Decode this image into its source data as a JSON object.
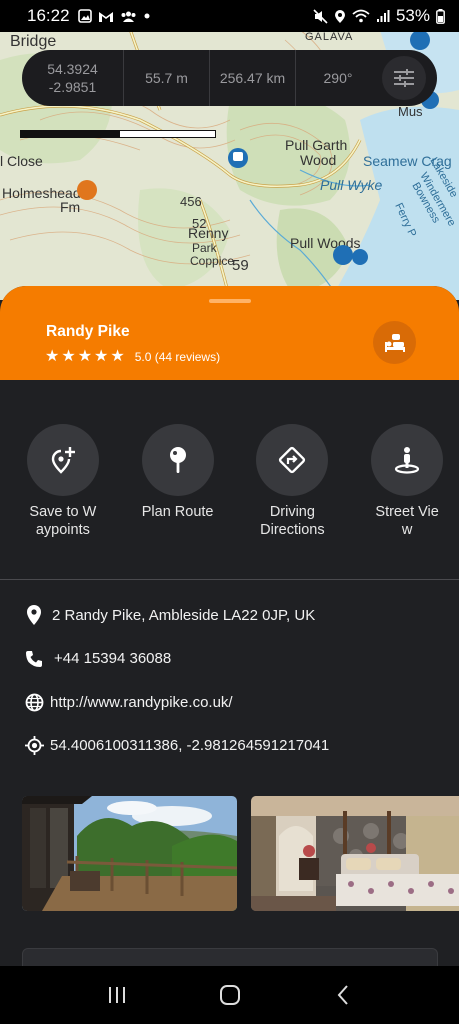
{
  "status_bar": {
    "time": "16:22",
    "battery_percent": "53%",
    "icons_left": [
      "photo-icon",
      "gallery-icon",
      "gmail-icon",
      "group-icon",
      "dot-icon"
    ],
    "icons_right": [
      "mute-icon",
      "location-icon",
      "wifi-icon",
      "signal-icon",
      "battery-icon"
    ]
  },
  "map": {
    "labels": [
      "Bridge",
      "Pull Garth Wood",
      "Seamew Crag",
      "Pull Wyke",
      "Holmeshead Fm",
      "Renny Park",
      "Pull Woods",
      "Bowness Windermere Lakeside",
      "Ferry P",
      "456",
      "52",
      "59",
      "GALAVA",
      "Mus",
      "l Close",
      "Coppice"
    ],
    "colors": {
      "land": "#dfe3cf",
      "water": "#bfe3f2",
      "road": "#f4f4c4",
      "wood": "#c8dcb0"
    }
  },
  "info_bar": {
    "latitude": "54.3924",
    "longitude": "-2.9851",
    "altitude": "55.7 m",
    "distance": "256.47 km",
    "heading": "290°",
    "filter_icon": "sliders-icon"
  },
  "scale_bar": {
    "fill_fraction": 0.51
  },
  "place": {
    "name": "Randy Pike",
    "rating_value": 5.0,
    "stars": 5,
    "rating_text": "5.0 (44 reviews)",
    "category_icon": "bed-icon",
    "accent_color": "#f57c00"
  },
  "actions": [
    {
      "label": "Save to Waypoints",
      "icon": "add-location-icon"
    },
    {
      "label": "Plan Route",
      "icon": "pin-icon"
    },
    {
      "label": "Driving Directions",
      "icon": "directions-icon"
    },
    {
      "label": "Street View",
      "icon": "street-view-icon"
    }
  ],
  "details": {
    "address": "2 Randy Pike, Ambleside LA22 0JP, UK",
    "phone": "+44 15394 36088",
    "website": "http://www.randypike.co.uk/",
    "coordinates": "54.4006100311386, -2.981264591217041"
  },
  "photos": [
    {
      "name": "deck-view-photo"
    },
    {
      "name": "bedroom-photo"
    }
  ],
  "nav": {
    "recents_icon": "recents-icon",
    "home_icon": "home-icon",
    "back_icon": "back-icon"
  }
}
